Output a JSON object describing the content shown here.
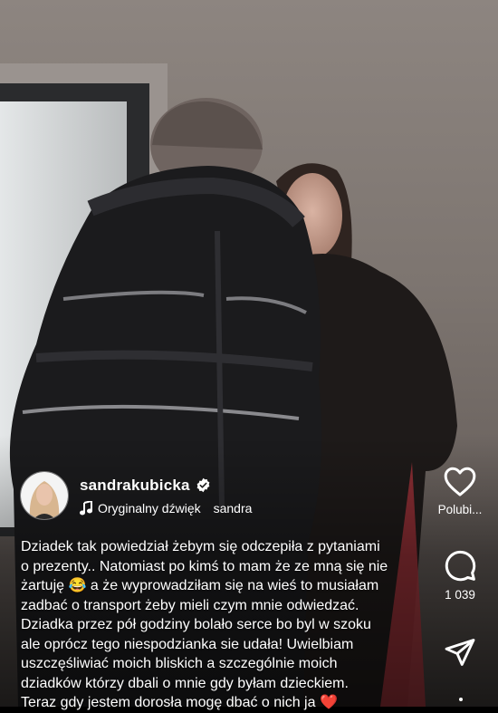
{
  "post": {
    "username": "sandrakubicka",
    "audio_label": "Oryginalny dźwięk",
    "audio_artist": "sandra",
    "caption": {
      "line1": "Dziadek tak powiedział żebym się odczepiła z pytaniami",
      "line2": "o prezenty.. Natomiast po kimś to mam że ze mną się nie",
      "line3a": "żartuję",
      "line3_emoji": "😂",
      "line3b": "a że wyprowadziłam się na wieś to musiałam",
      "line4": "zadbać o transport żeby mieli czym mnie odwiedzać.",
      "line5": "Dziadka przez pół godziny bolało serce bo byl w szoku",
      "line6": "ale oprócz tego niespodzianka sie udała! Uwielbiam",
      "line7": "uszczęśliwiać moich bliskich a szczególnie moich",
      "line8": "dziadków którzy dbali o mnie gdy byłam dzieckiem.",
      "line9": "Teraz gdy jestem dorosła mogę dbać o nich ja",
      "line9_emoji": "❤️"
    }
  },
  "actions": {
    "like_label": "Polubi...",
    "comment_count": "1 039"
  },
  "icons": {
    "like": "heart-icon",
    "comment": "comment-bubble-icon",
    "share": "paper-plane-icon",
    "audio": "music-note-icon",
    "verified": "verified-badge-icon"
  },
  "colors": {
    "verified_badge": "#ffffff",
    "heart_emoji": "#e0245e"
  }
}
